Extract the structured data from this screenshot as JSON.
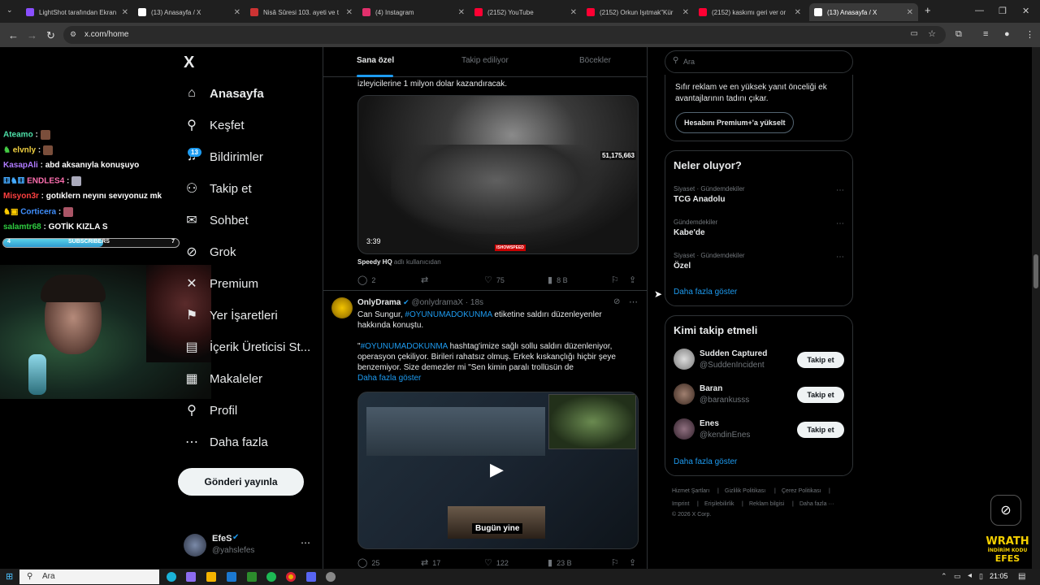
{
  "browser": {
    "tabs": [
      {
        "title": "LightShot tarafından Ekran",
        "color": "#8a4fff"
      },
      {
        "title": "(13) Anasayfa / X",
        "color": "#ffffff"
      },
      {
        "title": "Nisâ Sûresi 103. ayeti ve t",
        "color": "#cc3333"
      },
      {
        "title": "(4) Instagram",
        "color": "#e1306c"
      },
      {
        "title": "(2152) YouTube",
        "color": "#ff0033"
      },
      {
        "title": "(2152) Orkun Işıtmak\"Kür",
        "color": "#ff0033"
      },
      {
        "title": "(2152) kaskımı geri ver or",
        "color": "#ff0033"
      },
      {
        "title": "(13) Anasayfa / X",
        "color": "#ffffff"
      }
    ],
    "url": "x.com/home"
  },
  "stream": {
    "chat": [
      {
        "user": "Ateamo",
        "msg": "",
        "color": "#4de0a8"
      },
      {
        "user": "elvnly",
        "msg": "",
        "color": "#f0d040"
      },
      {
        "user": "KasapAli",
        "msg": "abd aksanıyla konuşuyo",
        "color": "#b07bff"
      },
      {
        "user": "ENDLES4",
        "msg": "",
        "color": "#ff6fb0"
      },
      {
        "user": "Misyon3r",
        "msg": "gotıklern neyını sevıyonuz mk",
        "color": "#ff4040"
      },
      {
        "user": "Corticera",
        "msg": "",
        "color": "#4090ff"
      },
      {
        "user": "salamtr68",
        "msg": "GOTİK KIZLA S",
        "color": "#2ecc40"
      }
    ],
    "sub_goal": {
      "label": "SUBSCRIBERS",
      "current": "4",
      "target": "7",
      "progress": 0.57
    },
    "promo": {
      "line1": "WRATH",
      "line2": "İNDİRİM KODU",
      "line3": "EFES"
    }
  },
  "nav": {
    "logo": "X",
    "items": [
      {
        "label": "Anasayfa",
        "icon": "home-icon"
      },
      {
        "label": "Keşfet",
        "icon": "search-icon"
      },
      {
        "label": "Bildirimler",
        "icon": "bell-icon"
      },
      {
        "label": "Takip et",
        "icon": "follow-icon"
      },
      {
        "label": "Sohbet",
        "icon": "mail-icon"
      },
      {
        "label": "Grok",
        "icon": "grok-icon"
      },
      {
        "label": "Premium",
        "icon": "x-premium-icon"
      },
      {
        "label": "Yer İşaretleri",
        "icon": "bookmark-icon"
      },
      {
        "label": "İçerik Üreticisi St...",
        "icon": "creator-icon"
      },
      {
        "label": "Makaleler",
        "icon": "article-icon"
      },
      {
        "label": "Profil",
        "icon": "profile-icon"
      },
      {
        "label": "Daha fazla",
        "icon": "more-icon"
      }
    ],
    "notif_count": "13",
    "post_button": "Gönderi yayınla",
    "profile": {
      "name": "EfeS",
      "handle": "@yahslefes"
    }
  },
  "feed": {
    "tabs": [
      "Sana özel",
      "Takip ediliyor",
      "Böcekler"
    ],
    "tweet1": {
      "text_tail": "izleyicilerine 1 milyon dolar kazandıracak.",
      "video_duration": "3:39",
      "video_count": "51,175,663",
      "watermark": "ISHOWSPEED",
      "source_name": "Speedy HQ",
      "source_suffix": "adlı kullanıcıdan",
      "replies": "2",
      "retweets": "",
      "likes": "75",
      "views": "8 B"
    },
    "tweet2": {
      "name": "OnlyDrama",
      "handle": "@onlydramaX",
      "time": "18s",
      "line1_pre": "Can Sungur,",
      "hashtag": "#OYUNUMADOKUNMA",
      "line1_post": "etiketine saldırı düzenleyenler",
      "line2": "hakkında konuştu.",
      "quote_open": "\"",
      "quote_tag": "#OYUNUMADOKUNMA",
      "quote_rest": "hashtag'imize sağlı sollu saldırı düzenleniyor, operasyon çekiliyor. Birileri rahatsız olmuş. Erkek kıskançlığı hiçbir şeye benzemiyor. Size demezler mi \"Sen kimin paralı trollüsün de",
      "show_more": "Daha fazla göster",
      "video_caption": "Bugün yine",
      "replies": "25",
      "retweets": "17",
      "likes": "122",
      "views": "23 B"
    }
  },
  "sidebar": {
    "search_placeholder": "Ara",
    "premium_text": "Sıfır reklam ve en yüksek yanıt önceliği ek avantajlarının tadını çıkar.",
    "premium_button": "Hesabını Premium+'a yükselt",
    "trends_title": "Neler oluyor?",
    "trends": [
      {
        "meta": "Siyaset · Gündemdekiler",
        "name": "TCG Anadolu"
      },
      {
        "meta": "Gündemdekiler",
        "name": "Kabe'de"
      },
      {
        "meta": "Siyaset · Gündemdekiler",
        "name": "Özel"
      }
    ],
    "show_more": "Daha fazla göster",
    "who_title": "Kimi takip etmeli",
    "who": [
      {
        "name": "Sudden Captured",
        "handle": "@SuddenIncident",
        "button": "Takip et"
      },
      {
        "name": "Baran",
        "handle": "@barankusss",
        "button": "Takip et"
      },
      {
        "name": "Enes",
        "handle": "@kendinEnes",
        "button": "Takip et"
      }
    ],
    "who_more": "Daha fazla göster",
    "footer": [
      "Hizmet Şartları",
      "|",
      "Gizlilik Politikası",
      "|",
      "Çerez Politikası",
      "|",
      "Imprint",
      "|",
      "Erişilebilirlik",
      "|",
      "Reklam bilgisi",
      "|",
      "Daha fazla ···",
      "© 2026 X Corp."
    ]
  },
  "taskbar": {
    "search": "Ara",
    "time": "21:05"
  },
  "colors": {
    "accent": "#1d9bf0",
    "bg": "#000000",
    "border": "#2f3336",
    "muted": "#71767b"
  }
}
